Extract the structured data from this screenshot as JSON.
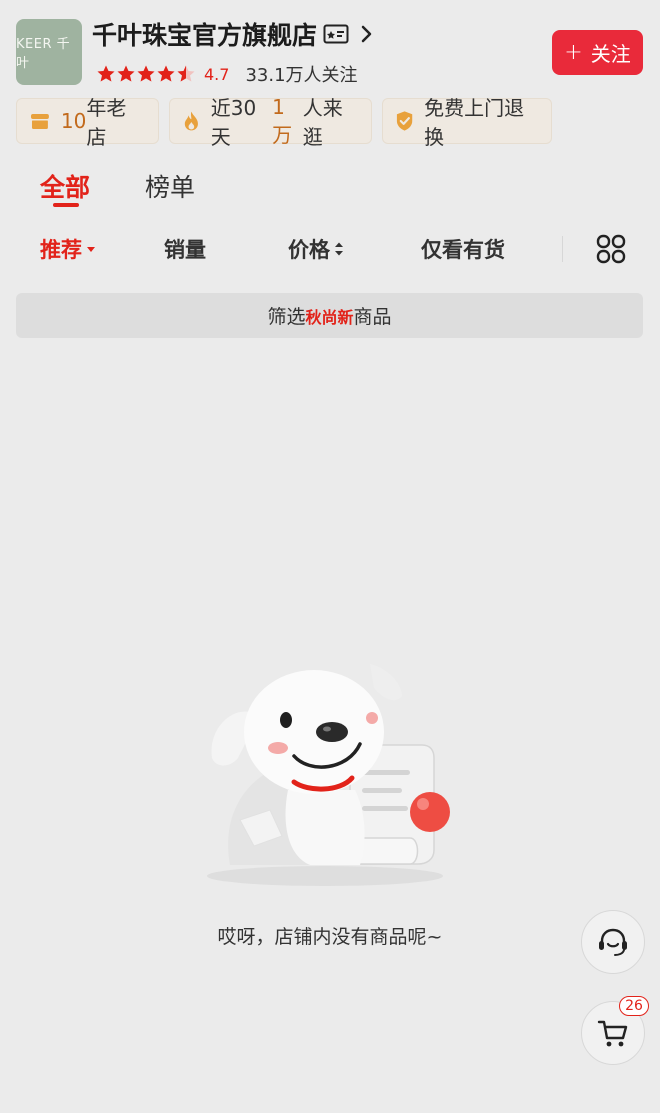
{
  "store": {
    "logo_text": "KEER 千叶",
    "name": "千叶珠宝官方旗舰店",
    "rating": "4.7",
    "rating_stars": 4.5,
    "followers": "33.1万人关注",
    "follow_button": "关注"
  },
  "badges": [
    {
      "icon": "store-icon",
      "highlight": "10",
      "text": " 年老店"
    },
    {
      "icon": "flame-icon",
      "prefix": "近30天",
      "highlight": "1万",
      "text": "人来逛"
    },
    {
      "icon": "shield-check-icon",
      "text": "免费上门退换"
    }
  ],
  "tabs": [
    {
      "label": "全部",
      "active": true
    },
    {
      "label": "榜单",
      "active": false
    }
  ],
  "sort_options": [
    {
      "label": "推荐",
      "active": true,
      "icon": "caret-down-icon"
    },
    {
      "label": "销量",
      "active": false
    },
    {
      "label": "价格",
      "active": false,
      "icon": "sort-arrows-icon"
    },
    {
      "label": "仅看有货",
      "active": false
    }
  ],
  "filter_banner": {
    "prefix": "筛选",
    "highlight": "秋尚新",
    "suffix": "商品"
  },
  "empty_state": {
    "message": "哎呀，店铺内没有商品呢~"
  },
  "floating": {
    "service_icon": "headset-icon",
    "cart_icon": "cart-icon",
    "cart_count": "26"
  },
  "colors": {
    "accent": "#e2231a",
    "follow_button": "#e92a3a",
    "badge_highlight": "#c26a1c",
    "background": "#ebebeb"
  }
}
